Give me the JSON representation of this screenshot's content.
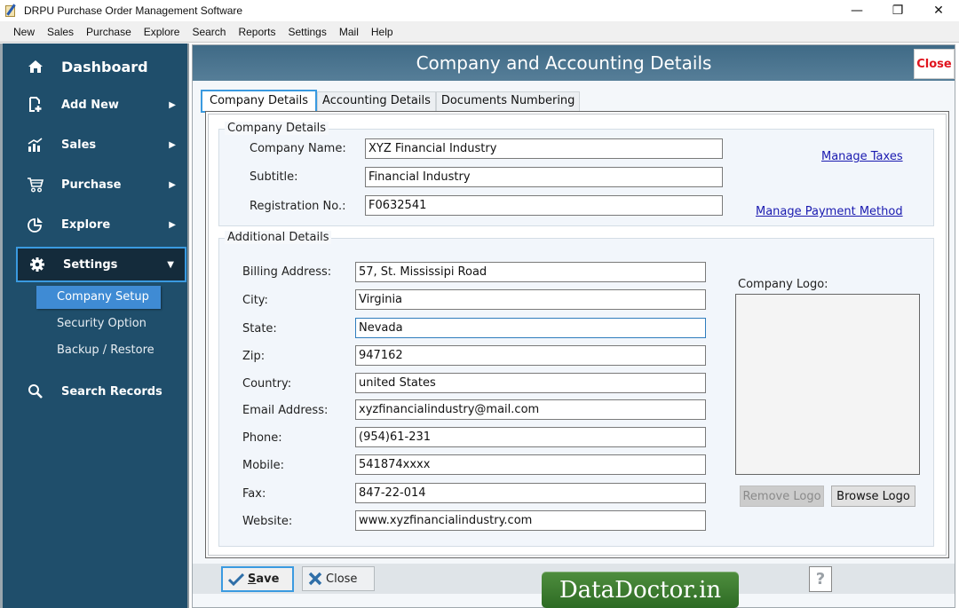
{
  "window": {
    "title": "DRPU Purchase Order Management Software",
    "controls": {
      "minimize": "—",
      "maximize": "❐",
      "close": "✕"
    }
  },
  "menu": [
    "New",
    "Sales",
    "Purchase",
    "Explore",
    "Search",
    "Reports",
    "Settings",
    "Mail",
    "Help"
  ],
  "sidebar": {
    "dashboard": {
      "label": "Dashboard",
      "icon": "home-icon"
    },
    "items": [
      {
        "label": "Add New",
        "icon": "add-document-icon",
        "arrow": "▶"
      },
      {
        "label": "Sales",
        "icon": "chart-up-icon",
        "arrow": "▶"
      },
      {
        "label": "Purchase",
        "icon": "cart-icon",
        "arrow": "▶"
      },
      {
        "label": "Explore",
        "icon": "pie-chart-icon",
        "arrow": "▶"
      },
      {
        "label": "Settings",
        "icon": "gear-icon",
        "arrow": "▼",
        "active": true
      }
    ],
    "settings_submenu": [
      {
        "label": "Company Setup",
        "selected": true
      },
      {
        "label": "Security Option"
      },
      {
        "label": "Backup / Restore"
      }
    ],
    "search": {
      "label": "Search Records",
      "icon": "search-icon"
    }
  },
  "header": {
    "title": "Company and Accounting Details",
    "close_label": "Close",
    "close_color": "#e0141e"
  },
  "tabs": [
    {
      "label": "Company Details",
      "active": true
    },
    {
      "label": "Accounting Details"
    },
    {
      "label": "Documents Numbering"
    }
  ],
  "company_details": {
    "group_label": "Company Details",
    "fields": [
      {
        "label": "Company Name:",
        "value": "XYZ Financial Industry"
      },
      {
        "label": "Subtitle:",
        "value": "Financial Industry"
      },
      {
        "label": "Registration No.:",
        "value": "F0632541"
      }
    ],
    "links": {
      "manage_taxes": "Manage Taxes",
      "manage_payment": "Manage Payment Method"
    }
  },
  "additional_details": {
    "group_label": "Additional Details",
    "fields": [
      {
        "label": "Billing Address:",
        "value": "57, St. Mississipi Road"
      },
      {
        "label": "City:",
        "value": "Virginia"
      },
      {
        "label": "State:",
        "value": "Nevada",
        "focused": true
      },
      {
        "label": "Zip:",
        "value": "947162"
      },
      {
        "label": "Country:",
        "value": "united States"
      },
      {
        "label": "Email Address:",
        "value": "xyzfinancialindustry@mail.com"
      },
      {
        "label": "Phone:",
        "value": "(954)61-231"
      },
      {
        "label": "Mobile:",
        "value": "541874xxxx"
      },
      {
        "label": "Fax:",
        "value": "847-22-014"
      },
      {
        "label": "Website:",
        "value": "www.xyzfinancialindustry.com"
      }
    ],
    "logo": {
      "label": "Company Logo:",
      "remove_label": "Remove Logo",
      "remove_enabled": false,
      "browse_label": "Browse Logo"
    }
  },
  "footer": {
    "save_label": "Save",
    "save_mnemonic": "S",
    "save_rest": "ave",
    "close_label": "Close",
    "brand": "DataDoctor.in",
    "help": "?"
  },
  "colors": {
    "sidebar_bg": "#1f4e6b",
    "accent_blue": "#3a9ae0",
    "brand_green": "#2d6b24"
  }
}
